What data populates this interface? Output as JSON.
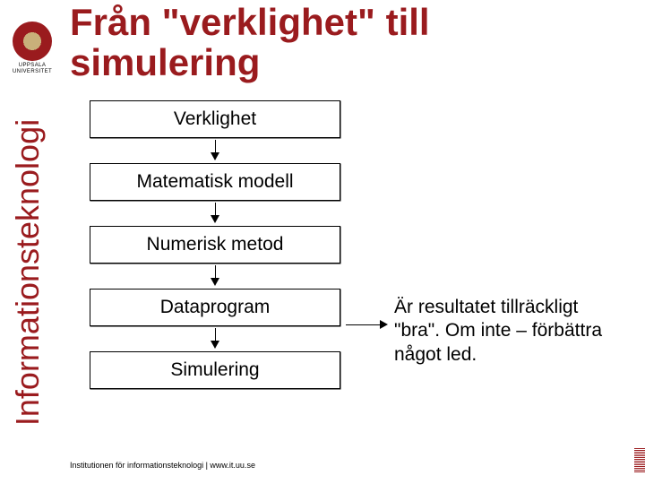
{
  "header": {
    "logo_line1": "UPPSALA",
    "logo_line2": "UNIVERSITET",
    "title": "Från \"verklighet\" till simulering"
  },
  "sidebar": {
    "vertical_label": "Informationsteknologi"
  },
  "flow": {
    "steps": [
      "Verklighet",
      "Matematisk modell",
      "Numerisk metod",
      "Dataprogram",
      "Simulering"
    ]
  },
  "annotation": {
    "text": "Är resultatet tillräckligt \"bra\". Om inte – förbättra något led."
  },
  "footer": {
    "text": "Institutionen för informationsteknologi | www.it.uu.se"
  }
}
